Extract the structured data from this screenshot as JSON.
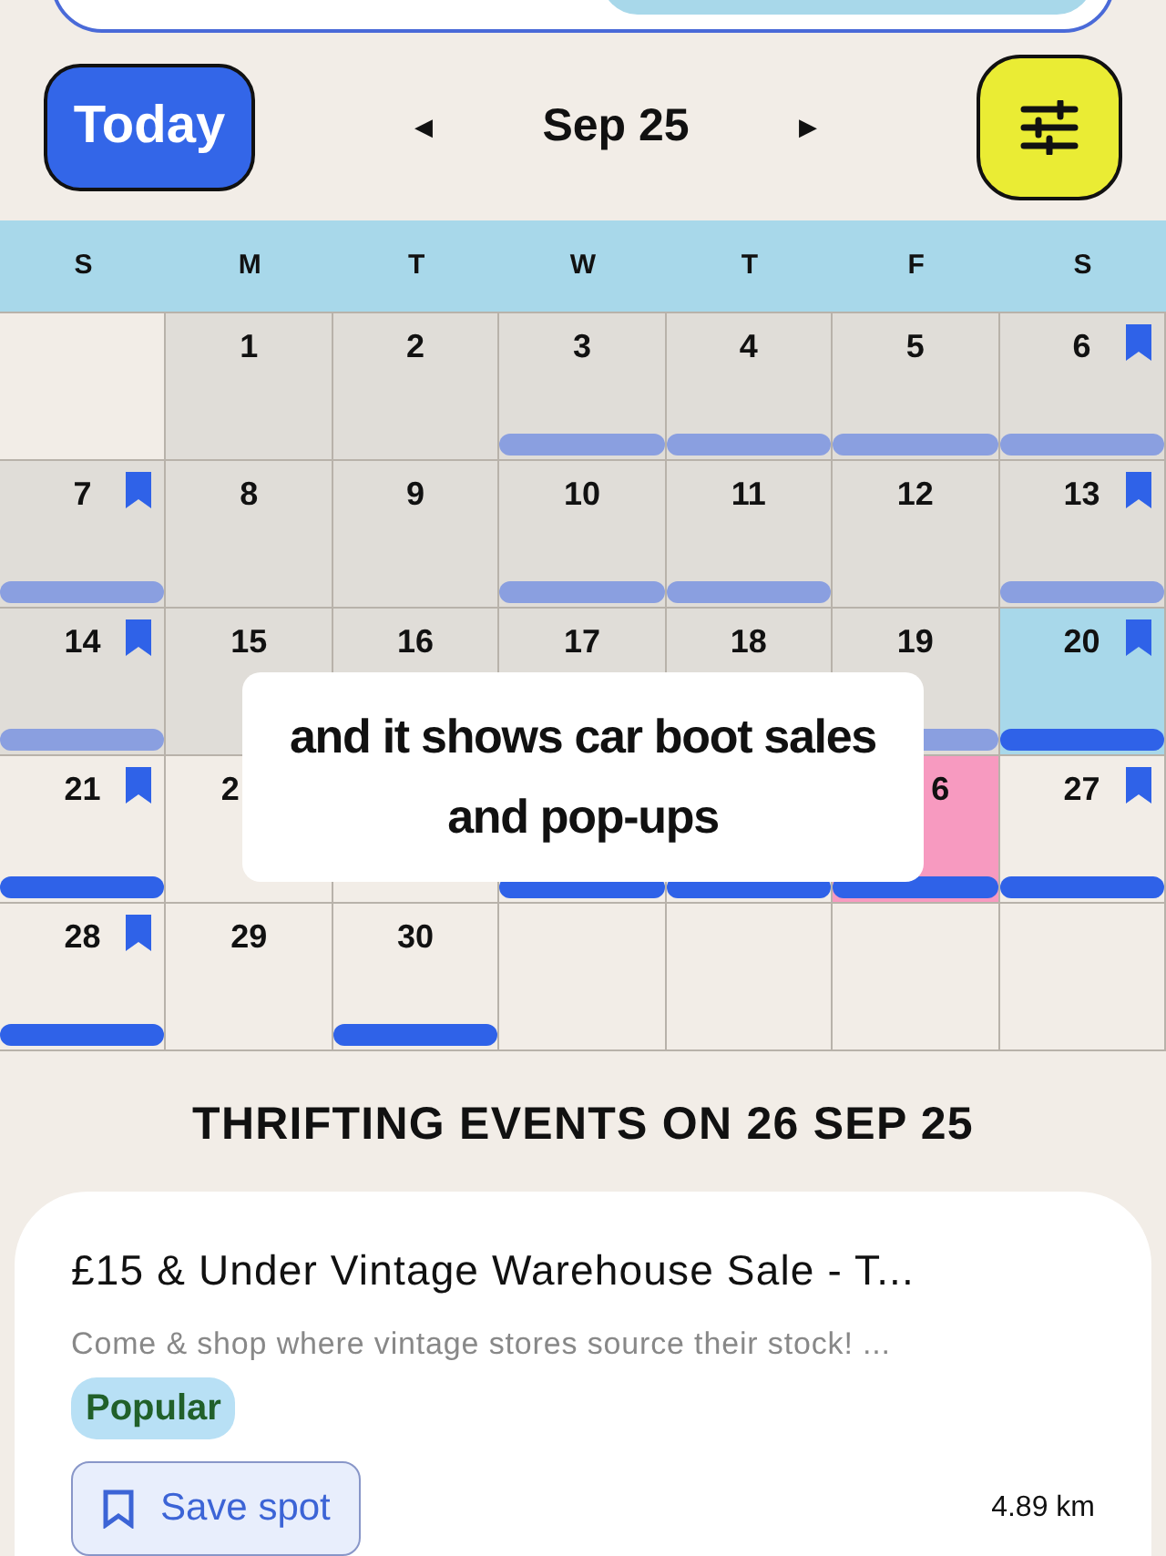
{
  "toolbar": {
    "today_button": "Today",
    "prev": "◀",
    "month": "Sep 25",
    "next": "▶"
  },
  "weekdays": [
    "S",
    "M",
    "T",
    "W",
    "T",
    "F",
    "S"
  ],
  "days": [
    {
      "kind": "blank"
    },
    {
      "kind": "day",
      "label": "1",
      "past": true,
      "today": false,
      "selected": false,
      "bookmarked": false,
      "has_events": false
    },
    {
      "kind": "day",
      "label": "2",
      "past": true,
      "today": false,
      "selected": false,
      "bookmarked": false,
      "has_events": false
    },
    {
      "kind": "day",
      "label": "3",
      "past": true,
      "today": false,
      "selected": false,
      "bookmarked": false,
      "has_events": true
    },
    {
      "kind": "day",
      "label": "4",
      "past": true,
      "today": false,
      "selected": false,
      "bookmarked": false,
      "has_events": true
    },
    {
      "kind": "day",
      "label": "5",
      "past": true,
      "today": false,
      "selected": false,
      "bookmarked": false,
      "has_events": true
    },
    {
      "kind": "day",
      "label": "6",
      "past": true,
      "today": false,
      "selected": false,
      "bookmarked": true,
      "has_events": true
    },
    {
      "kind": "day",
      "label": "7",
      "past": true,
      "today": false,
      "selected": false,
      "bookmarked": true,
      "has_events": true
    },
    {
      "kind": "day",
      "label": "8",
      "past": true,
      "today": false,
      "selected": false,
      "bookmarked": false,
      "has_events": false
    },
    {
      "kind": "day",
      "label": "9",
      "past": true,
      "today": false,
      "selected": false,
      "bookmarked": false,
      "has_events": false
    },
    {
      "kind": "day",
      "label": "10",
      "past": true,
      "today": false,
      "selected": false,
      "bookmarked": false,
      "has_events": true
    },
    {
      "kind": "day",
      "label": "11",
      "past": true,
      "today": false,
      "selected": false,
      "bookmarked": false,
      "has_events": true
    },
    {
      "kind": "day",
      "label": "12",
      "past": true,
      "today": false,
      "selected": false,
      "bookmarked": false,
      "has_events": false
    },
    {
      "kind": "day",
      "label": "13",
      "past": true,
      "today": false,
      "selected": false,
      "bookmarked": true,
      "has_events": true
    },
    {
      "kind": "day",
      "label": "14",
      "past": true,
      "today": false,
      "selected": false,
      "bookmarked": true,
      "has_events": true
    },
    {
      "kind": "day",
      "label": "15",
      "past": true,
      "today": false,
      "selected": false,
      "bookmarked": false,
      "has_events": false
    },
    {
      "kind": "day",
      "label": "16",
      "past": true,
      "today": false,
      "selected": false,
      "bookmarked": false,
      "has_events": false
    },
    {
      "kind": "day",
      "label": "17",
      "past": true,
      "today": false,
      "selected": false,
      "bookmarked": false,
      "has_events": false
    },
    {
      "kind": "day",
      "label": "18",
      "past": true,
      "today": false,
      "selected": false,
      "bookmarked": false,
      "has_events": false
    },
    {
      "kind": "day",
      "label": "19",
      "past": true,
      "today": false,
      "selected": false,
      "bookmarked": false,
      "has_events": true
    },
    {
      "kind": "day",
      "label": "20",
      "past": false,
      "today": true,
      "selected": false,
      "bookmarked": true,
      "has_events": true
    },
    {
      "kind": "day",
      "label": "21",
      "past": false,
      "today": false,
      "selected": false,
      "bookmarked": true,
      "has_events": true
    },
    {
      "kind": "partial_start",
      "label": "2",
      "past": false,
      "today": false,
      "selected": false,
      "bookmarked": false,
      "has_events": false
    },
    {
      "kind": "hidden",
      "past": false,
      "today": false,
      "selected": false,
      "bookmarked": false,
      "has_events": false
    },
    {
      "kind": "hidden",
      "past": false,
      "today": false,
      "selected": false,
      "bookmarked": false,
      "has_events": true
    },
    {
      "kind": "hidden",
      "past": false,
      "today": false,
      "selected": false,
      "bookmarked": false,
      "has_events": true
    },
    {
      "kind": "partial_end",
      "label": "6",
      "past": false,
      "today": false,
      "selected": true,
      "bookmarked": false,
      "has_events": true
    },
    {
      "kind": "day",
      "label": "27",
      "past": false,
      "today": false,
      "selected": false,
      "bookmarked": true,
      "has_events": true
    },
    {
      "kind": "day",
      "label": "28",
      "past": false,
      "today": false,
      "selected": false,
      "bookmarked": true,
      "has_events": true
    },
    {
      "kind": "day",
      "label": "29",
      "past": false,
      "today": false,
      "selected": false,
      "bookmarked": false,
      "has_events": false
    },
    {
      "kind": "day",
      "label": "30",
      "past": false,
      "today": false,
      "selected": false,
      "bookmarked": false,
      "has_events": true
    },
    {
      "kind": "blank"
    },
    {
      "kind": "blank"
    },
    {
      "kind": "blank"
    },
    {
      "kind": "blank"
    }
  ],
  "caption": [
    "and it shows car boot sales",
    "and pop-ups"
  ],
  "events_heading": "THRIFTING EVENTS ON 26 SEP 25",
  "event": {
    "title": "£15 & Under Vintage Warehouse Sale - T...",
    "description": "Come & shop where vintage stores source their stock! ...",
    "badge": "Popular",
    "save_button": "Save spot",
    "distance": "4.89 km"
  }
}
